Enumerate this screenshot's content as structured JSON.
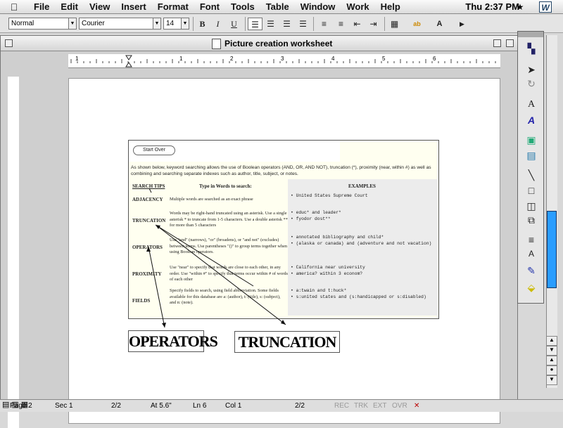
{
  "menubar": {
    "items": [
      "File",
      "Edit",
      "View",
      "Insert",
      "Format",
      "Font",
      "Tools",
      "Table",
      "Window",
      "Work",
      "Help"
    ],
    "clock": "Thu 2:37 PM"
  },
  "toolbar": {
    "style": "Normal",
    "font": "Courier",
    "size": "14",
    "bold": "B",
    "italic": "I",
    "underline": "U"
  },
  "window": {
    "title": "Picture creation worksheet"
  },
  "ruler": {
    "numbers": [
      "1",
      "1",
      "2",
      "3",
      "4",
      "5",
      "6"
    ]
  },
  "picture": {
    "start_over": "Start Over",
    "intro": "As shown below, keyword searching allows the use of Boolean operators (AND, OR, AND NOT), truncation (*), proximity (near, within #) as well as combining and searching separate indexes such as author, title, subject, or notes.",
    "headers": {
      "tips": "SEARCH TIPS",
      "type": "Type in Words to search:",
      "examples": "EXAMPLES"
    },
    "rows": [
      {
        "name": "ADJACENCY",
        "desc": "Multiple words are searched as an exact phrase",
        "examples": [
          "United States Supreme Court"
        ]
      },
      {
        "name": "TRUNCATION",
        "desc": "Words may be right-hand truncated using an asterisk. Use a single asterisk * to truncate from 1-5 characters. Use a double asterisk ** for more than 5 characters",
        "examples": [
          "educ* and leader*",
          "fyodor dost**"
        ]
      },
      {
        "name": "OPERATORS",
        "desc": "Use \"and\" (narrows), \"or\" (broadens), or \"and not\" (excludes) between terms. Use parentheses \"()\" to group terms together when using Boolean operators.",
        "examples": [
          "annotated bibliography and child*",
          "(alaska or canada) and (adventure and not vacation)"
        ]
      },
      {
        "name": "PROXIMITY",
        "desc": "Use \"near\" to specify that words are close to each other, in any order. Use \"within #\" to specify that terms occur within # of words of each other",
        "examples": [
          "California near university",
          "america? within 3 econom?"
        ]
      },
      {
        "name": "FIELDS",
        "desc": "Specify fields to search, using field abbreviation. Some fields available for this database are a: (author), t: (title), s: (subject), and n: (note).",
        "examples": [
          "a:twain and t:huck*",
          "s:united states and (s:handicapped or s:disabled)"
        ]
      }
    ]
  },
  "labels": {
    "operators": "OPERATORS",
    "truncation": "TRUNCATION"
  },
  "status": {
    "page": "Page 2",
    "sec": "Sec 1",
    "pages": "2/2",
    "at": "At 5.6\"",
    "ln": "Ln 6",
    "col": "Col 1",
    "pages2": "2/2",
    "rec": "REC",
    "trk": "TRK",
    "ext": "EXT",
    "ovr": "OVR"
  },
  "colors": {
    "scroll_thumb": "#2a9dff",
    "picture_bg": "#fffff0"
  },
  "icons": [
    "apple-icon",
    "word-icon",
    "pointer-icon",
    "rotate-icon",
    "text-box-icon",
    "wordart-icon",
    "line-icon",
    "rectangle-icon",
    "fill-icon"
  ]
}
